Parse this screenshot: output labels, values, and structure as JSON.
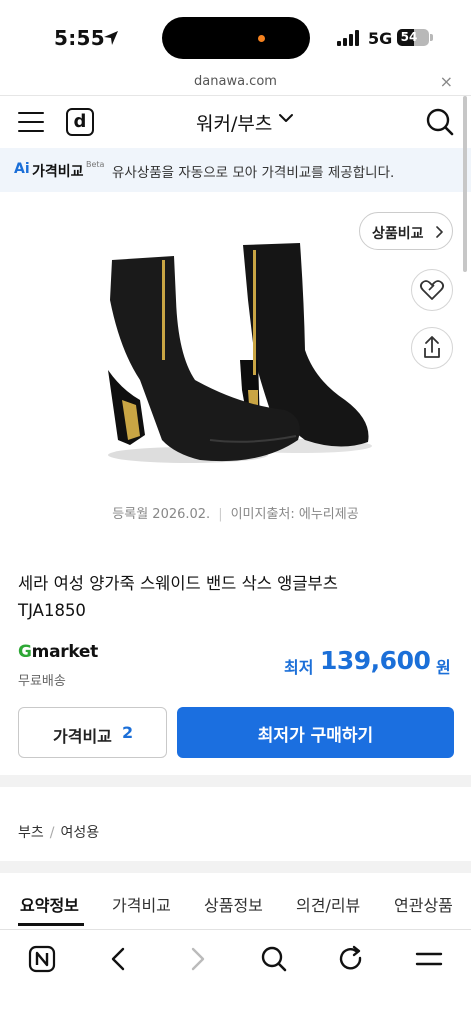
{
  "status": {
    "time": "5:55",
    "network": "5G",
    "battery": "54",
    "battery_level": 0.54
  },
  "browser": {
    "url": "danawa.com",
    "close_glyph": "×"
  },
  "header": {
    "logo_letter": "d",
    "category": "워커/부츠"
  },
  "ai_banner": {
    "badge": "Ai",
    "title": "가격비교",
    "beta": "Beta",
    "description": "유사상품을 자동으로 모아 가격비교를 제공합니다."
  },
  "product": {
    "compare_label": "상품비교",
    "registered": "등록월 2026.02.",
    "image_source": "이미지출처: 에누리제공",
    "title_line1": "세라 여성 양가죽 스웨이드 밴드 삭스 앵글부츠",
    "title_line2": "TJA1850",
    "seller": {
      "g": "G",
      "rest": "market"
    },
    "delivery": "무료배송",
    "price_label": "최저",
    "price": "139,600",
    "price_unit": "원",
    "compare_button": "가격비교",
    "compare_count": "2",
    "buy_button": "최저가 구매하기"
  },
  "breadcrumb": {
    "level1": "부츠",
    "separator": "/",
    "level2": "여성용"
  },
  "tabs": [
    "요약정보",
    "가격비교",
    "상품정보",
    "의견/리뷰",
    "연관상품"
  ],
  "icons": {
    "menu": "hamburger-icon",
    "search": "search-icon",
    "wish": "heart-icon",
    "share": "share-icon",
    "toolbar": [
      "naver-n-icon",
      "back-icon",
      "forward-icon",
      "search-icon",
      "reload-icon",
      "menu-icon"
    ]
  },
  "colors": {
    "accent": "#1b6fe0",
    "price": "#1b6fd8",
    "gmarket_g": "#2ea836",
    "banner_bg": "#f0f5fb"
  }
}
